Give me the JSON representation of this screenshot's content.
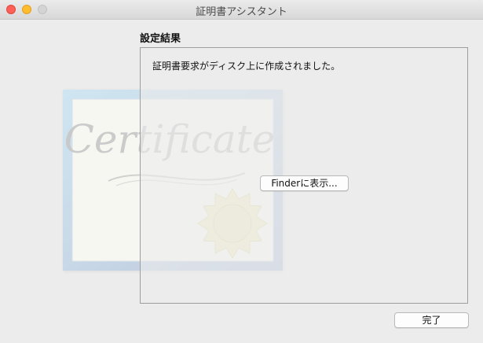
{
  "window": {
    "title": "証明書アシスタント"
  },
  "section": {
    "title": "設定結果"
  },
  "message": "証明書要求がディスク上に作成されました。",
  "buttons": {
    "show_in_finder": "Finderに表示...",
    "done": "完了"
  },
  "certificate_art": {
    "watermark_text": "Certificate"
  },
  "traffic_lights": {
    "close_color": "#fe5f57",
    "minimize_color": "#febc2e",
    "zoom_color": "#d4d4d4"
  }
}
